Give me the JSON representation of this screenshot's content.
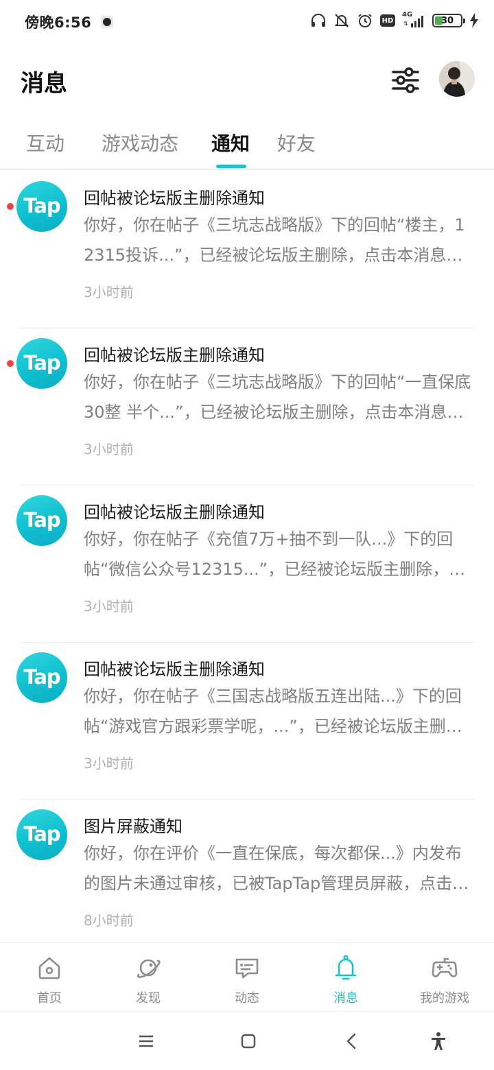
{
  "status_bar": {
    "time": "傍晚6:56",
    "network": "4G",
    "battery": "30",
    "battery_level": 0.3
  },
  "header": {
    "title": "消息",
    "filter_icon": "filter-sliders-icon",
    "avatar_icon": "user-avatar"
  },
  "tabs": [
    {
      "label": "互动",
      "active": false
    },
    {
      "label": "游戏动态",
      "active": false
    },
    {
      "label": "通知",
      "active": true
    },
    {
      "label": "好友",
      "active": false
    }
  ],
  "notifications": [
    {
      "logo": "Tap",
      "unread": true,
      "title": "回帖被论坛版主删除通知",
      "body": "你好，你在帖子《三坑志战略版》下的回帖“楼主，12315投诉...”，已经被论坛版主删除，点击本消息查看详情",
      "time": "3小时前"
    },
    {
      "logo": "Tap",
      "unread": true,
      "title": "回帖被论坛版主删除通知",
      "body": "你好，你在帖子《三坑志战略版》下的回帖“一直保底30整 半个...”，已经被论坛版主删除，点击本消息查看详情",
      "time": "3小时前"
    },
    {
      "logo": "Tap",
      "unread": false,
      "title": "回帖被论坛版主删除通知",
      "body": "你好，你在帖子《充值7万+抽不到一队...》下的回帖“微信公众号12315...”，已经被论坛版主删除，点击本消息查看详情",
      "time": "3小时前"
    },
    {
      "logo": "Tap",
      "unread": false,
      "title": "回帖被论坛版主删除通知",
      "body": "你好，你在帖子《三国志战略版五连出陆...》下的回帖“游戏官方跟彩票学呢，...”，已经被论坛版主删除，点击本消息查看详情",
      "time": "3小时前"
    },
    {
      "logo": "Tap",
      "unread": false,
      "title": "图片屏蔽通知",
      "body": "你好，你在评价《一直在保底，每次都保...》内发布的图片未通过审核，已被TapTap管理员屏蔽，点击本消息查看详情",
      "time": "8小时前"
    }
  ],
  "bottom_nav": [
    {
      "label": "首页",
      "icon": "home-icon",
      "active": false
    },
    {
      "label": "发现",
      "icon": "planet-icon",
      "active": false
    },
    {
      "label": "动态",
      "icon": "chat-bubble-icon",
      "active": false
    },
    {
      "label": "消息",
      "icon": "bell-icon",
      "active": true
    },
    {
      "label": "我的游戏",
      "icon": "gamepad-icon",
      "active": false
    }
  ],
  "colors": {
    "accent": "#15c5ce",
    "unread_dot": "#ef4346",
    "text_primary": "#1d1d1d",
    "text_secondary": "#808080",
    "text_muted": "#b0b0b0"
  }
}
